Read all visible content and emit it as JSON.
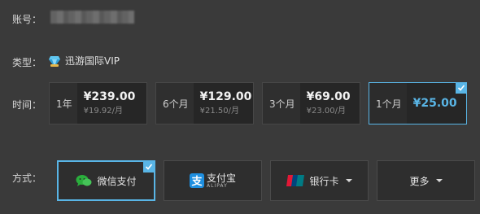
{
  "account": {
    "label": "账号："
  },
  "type": {
    "label": "类型：",
    "name": "迅游国际VIP",
    "icon": "diamond-icon"
  },
  "time": {
    "label": "时间：",
    "plans": [
      {
        "duration": "1年",
        "price": "¥239.00",
        "monthly": "¥19.92/月"
      },
      {
        "duration": "6个月",
        "price": "¥129.00",
        "monthly": "¥21.50/月"
      },
      {
        "duration": "3个月",
        "price": "¥69.00",
        "monthly": "¥23.00/月"
      },
      {
        "duration": "1个月",
        "price": "¥25.00",
        "selected": true
      }
    ]
  },
  "method": {
    "label": "方式：",
    "options": [
      {
        "label": "微信支付",
        "icon": "wechat-icon",
        "selected": true
      },
      {
        "label_cn": "支付宝",
        "label_en": "ALIPAY",
        "icon": "alipay-icon"
      },
      {
        "label": "银行卡",
        "icon": "unionpay-icon",
        "dropdown": true
      },
      {
        "label": "更多",
        "dropdown": true
      }
    ]
  },
  "colors": {
    "accent": "#59b5e6",
    "background": "#3a3a3a",
    "wechat": "#2aae3c",
    "alipay": "#1e8fe0"
  }
}
